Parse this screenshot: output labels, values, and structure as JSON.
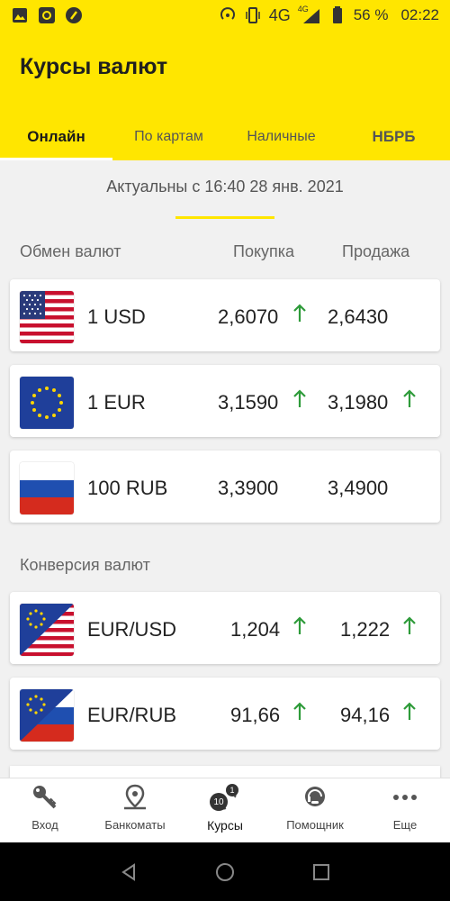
{
  "status_bar": {
    "network": "4G",
    "network_small": "4G",
    "battery": "56 %",
    "time": "02:22"
  },
  "header": {
    "title": "Курсы валют",
    "tabs": [
      {
        "label": "Онлайн",
        "active": true
      },
      {
        "label": "По картам"
      },
      {
        "label": "Наличные"
      },
      {
        "label": "НБРБ"
      }
    ]
  },
  "updated_text": "Актуальны с 16:40  28 янв. 2021",
  "exchange": {
    "section_label": "Обмен валют",
    "buy_label": "Покупка",
    "sell_label": "Продажа",
    "rows": [
      {
        "currency": "1 USD",
        "flag": "us-flag",
        "buy": "2,6070",
        "buy_up": true,
        "sell": "2,6430",
        "sell_up": false
      },
      {
        "currency": "1 EUR",
        "flag": "eu-flag",
        "buy": "3,1590",
        "buy_up": true,
        "sell": "3,1980",
        "sell_up": true
      },
      {
        "currency": "100 RUB",
        "flag": "ru-flag",
        "buy": "3,3900",
        "buy_up": false,
        "sell": "3,4900",
        "sell_up": false
      }
    ]
  },
  "conversion": {
    "section_label": "Конверсия валют",
    "rows": [
      {
        "pair": "EUR/USD",
        "flag": "eu-us-flag",
        "buy": "1,204",
        "buy_up": true,
        "sell": "1,222",
        "sell_up": true
      },
      {
        "pair": "EUR/RUB",
        "flag": "eu-ru-flag",
        "buy": "91,66",
        "buy_up": true,
        "sell": "94,16",
        "sell_up": true
      }
    ]
  },
  "bottom_nav": [
    {
      "label": "Вход",
      "icon": "key-icon"
    },
    {
      "label": "Банкоматы",
      "icon": "map-pin-icon"
    },
    {
      "label": "Курсы",
      "icon": "exchange-icon",
      "active": true,
      "badges": [
        "1",
        "10"
      ]
    },
    {
      "label": "Помощник",
      "icon": "assistant-icon"
    },
    {
      "label": "Еще",
      "icon": "more-icon"
    }
  ],
  "colors": {
    "brand": "#ffe600",
    "up_arrow": "#2e9b3a"
  }
}
